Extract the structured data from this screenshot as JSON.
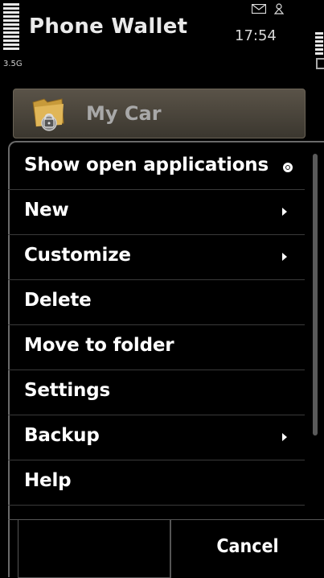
{
  "status": {
    "app_title": "Phone Wallet",
    "time": "17:54",
    "network": "3.5G"
  },
  "background": {
    "item_label": "My Car",
    "item_icon": "locked-folder-icon"
  },
  "menu": {
    "items": [
      {
        "label": "Show open applications",
        "indicator": "radio"
      },
      {
        "label": "New",
        "indicator": "submenu"
      },
      {
        "label": "Customize",
        "indicator": "submenu"
      },
      {
        "label": "Delete",
        "indicator": ""
      },
      {
        "label": "Move to folder",
        "indicator": ""
      },
      {
        "label": "Settings",
        "indicator": ""
      },
      {
        "label": "Backup",
        "indicator": "submenu"
      },
      {
        "label": "Help",
        "indicator": ""
      }
    ]
  },
  "softkeys": {
    "left": "",
    "right": "Cancel"
  }
}
